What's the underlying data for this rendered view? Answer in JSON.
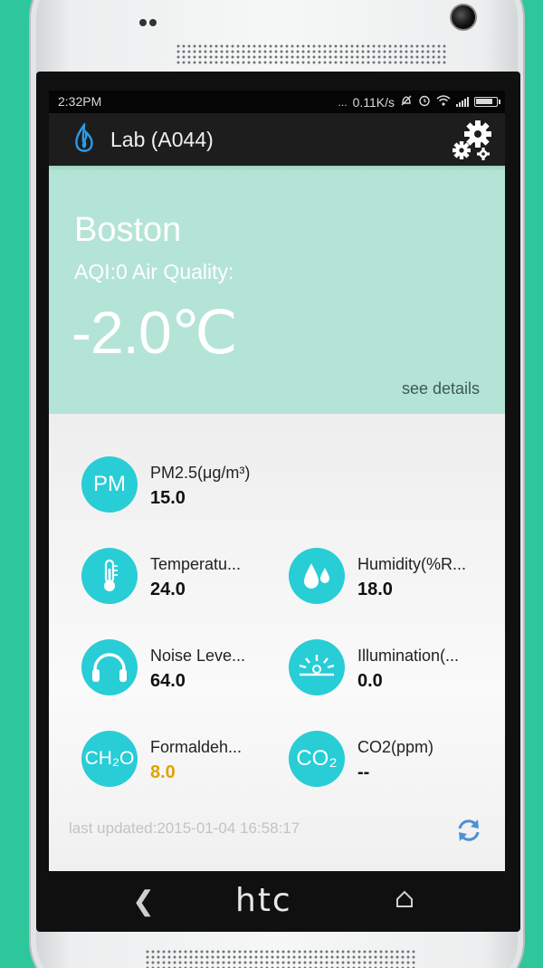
{
  "device": {
    "brand": "htc"
  },
  "status_bar": {
    "time": "2:32PM",
    "dots": "...",
    "net_speed": "0.11K/s",
    "battery_level": 0.85
  },
  "action_bar": {
    "title": "Lab (A044)",
    "icons": {
      "logo": "flame-logo-icon",
      "settings": "gears-icon"
    }
  },
  "hero": {
    "city": "Boston",
    "aqi_line": "AQI:0 Air Quality:",
    "temperature": "-2.0℃",
    "see_details": "see details",
    "bg_color": "#b4e4d6"
  },
  "sensors": [
    {
      "id": "pm25",
      "icon_text": "PM",
      "label": "PM2.5(μg/m³)",
      "value": "15.0"
    },
    {
      "id": "temperature",
      "icon": "thermometer-icon",
      "label": "Temperatu...",
      "value": "24.0"
    },
    {
      "id": "humidity",
      "icon": "water-drops-icon",
      "label": "Humidity(%R...",
      "value": "18.0"
    },
    {
      "id": "noise",
      "icon": "headphones-icon",
      "label": "Noise Leve...",
      "value": "64.0"
    },
    {
      "id": "illumination",
      "icon": "light-rays-icon",
      "label": "Illumination(...",
      "value": "0.0"
    },
    {
      "id": "formaldehyde",
      "icon_text": "CH₂O",
      "label": "Formaldeh...",
      "value": "8.0",
      "status_color": "#e0a300"
    },
    {
      "id": "co2",
      "icon_text": "CO₂",
      "label": "CO2(ppm)",
      "value": "--"
    }
  ],
  "footer": {
    "last_updated": "last updated:2015-01-04 16:58:17",
    "refresh_icon": "refresh-icon"
  },
  "colors": {
    "accent": "#28cdd6",
    "warning": "#e0a300"
  },
  "nav": {
    "back_icon": "back-icon",
    "home_icon": "home-icon"
  }
}
